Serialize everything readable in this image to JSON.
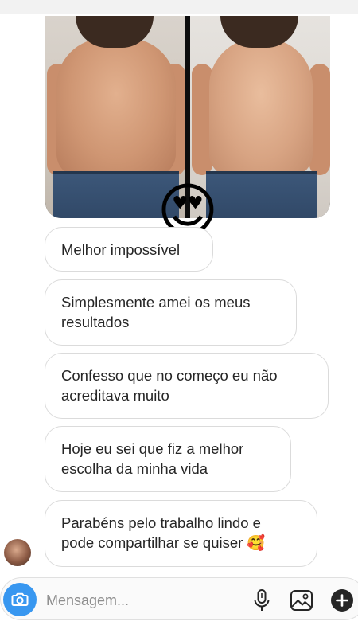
{
  "thread": {
    "photo_message": {
      "reaction_emoji": "😍"
    },
    "messages": [
      {
        "text": "Melhor impossível"
      },
      {
        "text": "Simplesmente amei os meus\nresultados"
      },
      {
        "text": "Confesso que no começo eu não\nacreditava muito"
      },
      {
        "text": "Hoje eu sei que fiz a melhor\nescolha da minha vida"
      },
      {
        "text": "Parabéns pelo trabalho lindo e\npode compartilhar se quiser 🥰"
      }
    ]
  },
  "composer": {
    "placeholder": "Mensagem...",
    "value": "",
    "icons": [
      "camera-icon",
      "microphone-icon",
      "gallery-icon",
      "plus-icon"
    ],
    "camera_color": "#3897f0"
  }
}
